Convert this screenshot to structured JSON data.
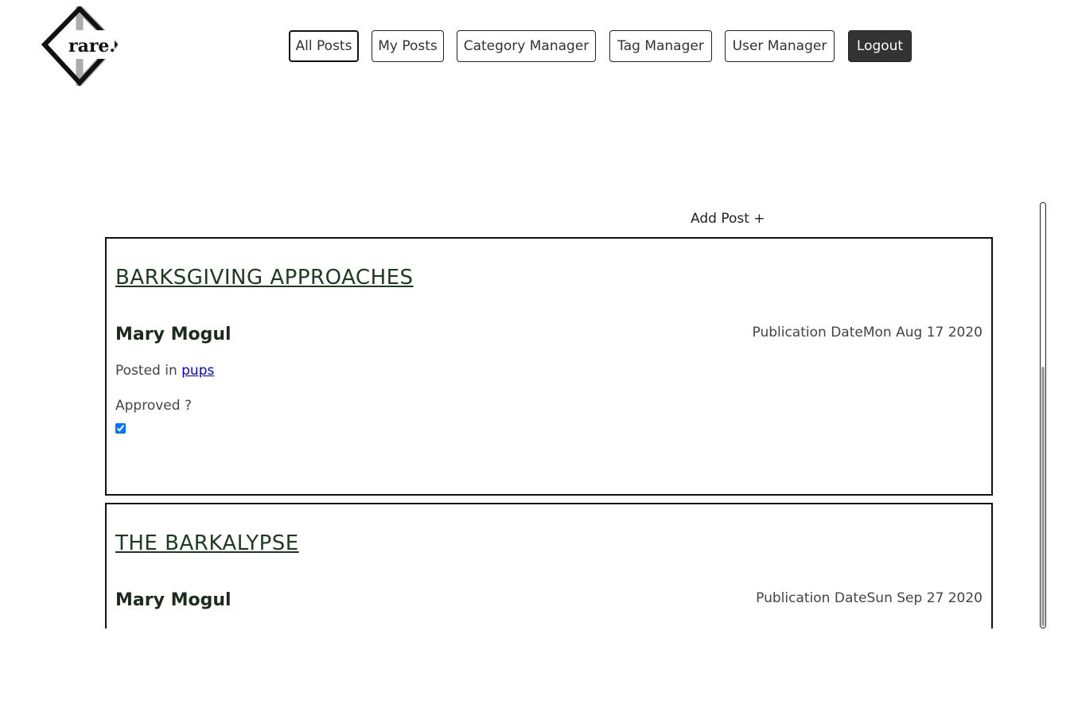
{
  "logo": {
    "text": "rare."
  },
  "nav": {
    "all_posts": "All Posts",
    "my_posts": "My Posts",
    "category_manager": "Category Manager",
    "tag_manager": "Tag Manager",
    "user_manager": "User Manager",
    "logout": "Logout"
  },
  "add_post": "Add Post +",
  "posts": [
    {
      "title": "BARKSGIVING APPROACHES",
      "author": "Mary Mogul",
      "date_label": "Publication Date",
      "date": "Mon Aug 17 2020",
      "posted_in": "Posted in",
      "category": "pups",
      "approved_label": "Approved ?",
      "approved": true
    },
    {
      "title": "THE BARKALYPSE",
      "author": "Mary Mogul",
      "date_label": "Publication Date",
      "date": "Sun Sep 27 2020"
    }
  ],
  "scroll_position": 0.38
}
